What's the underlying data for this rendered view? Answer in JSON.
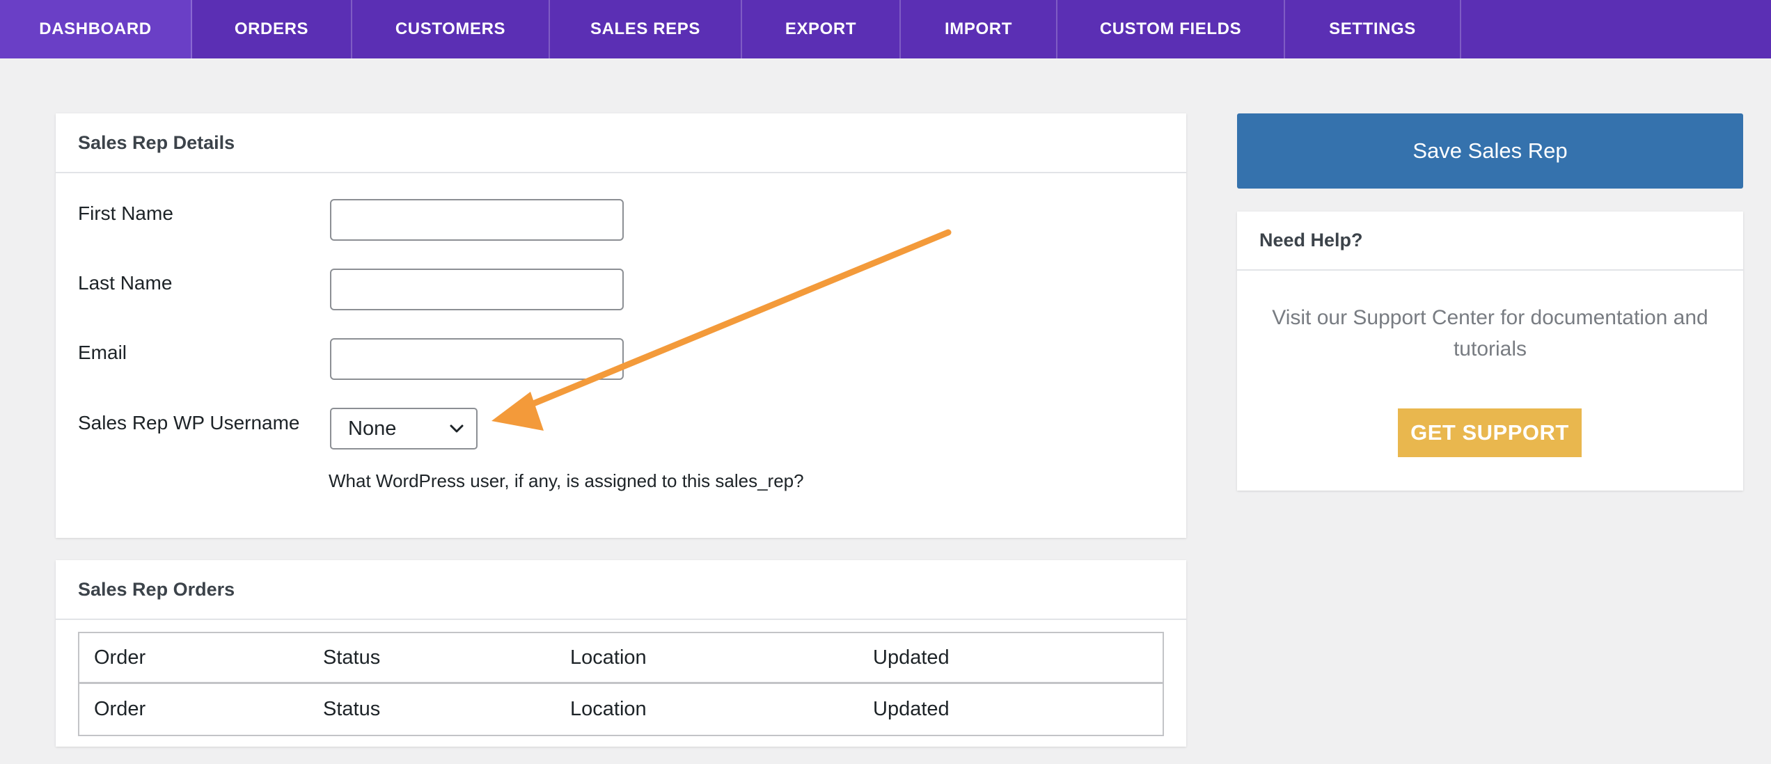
{
  "nav": {
    "tabs": [
      {
        "label": "DASHBOARD"
      },
      {
        "label": "ORDERS"
      },
      {
        "label": "CUSTOMERS"
      },
      {
        "label": "SALES REPS"
      },
      {
        "label": "EXPORT"
      },
      {
        "label": "IMPORT"
      },
      {
        "label": "CUSTOM FIELDS"
      },
      {
        "label": "SETTINGS"
      }
    ],
    "active_tab": "DASHBOARD",
    "background_color": "#5b2fb4"
  },
  "details": {
    "title": "Sales Rep Details",
    "first_name": {
      "label": "First Name",
      "value": ""
    },
    "last_name": {
      "label": "Last Name",
      "value": ""
    },
    "email": {
      "label": "Email",
      "value": ""
    },
    "wp_username": {
      "label": "Sales Rep WP Username",
      "selected": "None",
      "help": "What WordPress user, if any, is assigned to this sales_rep?"
    }
  },
  "orders": {
    "title": "Sales Rep Orders",
    "columns": [
      "Order",
      "Status",
      "Location",
      "Updated"
    ],
    "rows": [
      [
        "Order",
        "Status",
        "Location",
        "Updated"
      ]
    ]
  },
  "sidebar": {
    "save_label": "Save Sales Rep",
    "save_color": "#3572ad",
    "help_title": "Need Help?",
    "help_text": "Visit our Support Center for documentation and tutorials",
    "support_label": "GET SUPPORT",
    "support_color": "#e9b74e"
  },
  "annotation": {
    "icon": "arrow-icon",
    "color": "#f39a3a"
  }
}
